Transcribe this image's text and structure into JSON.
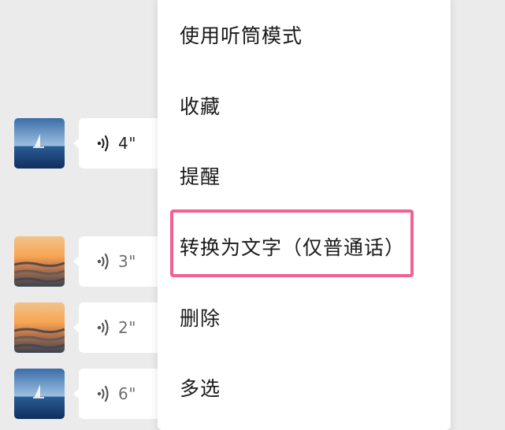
{
  "messages": [
    {
      "avatar": "sailboat-sea",
      "duration": "4\""
    },
    {
      "avatar": "sunset-sea",
      "duration": "3\""
    },
    {
      "avatar": "sunset-sea",
      "duration": "2\""
    },
    {
      "avatar": "sailboat-sea",
      "duration": "6\""
    }
  ],
  "menu": {
    "items": [
      {
        "label": "使用听筒模式"
      },
      {
        "label": "收藏"
      },
      {
        "label": "提醒"
      },
      {
        "label": "转换为文字（仅普通话）"
      },
      {
        "label": "删除"
      },
      {
        "label": "多选"
      }
    ]
  },
  "colors": {
    "background": "#ebebeb",
    "highlight": "#f06292",
    "bubble": "#ffffff"
  },
  "icons": {
    "voice": "voice-wave-icon"
  }
}
